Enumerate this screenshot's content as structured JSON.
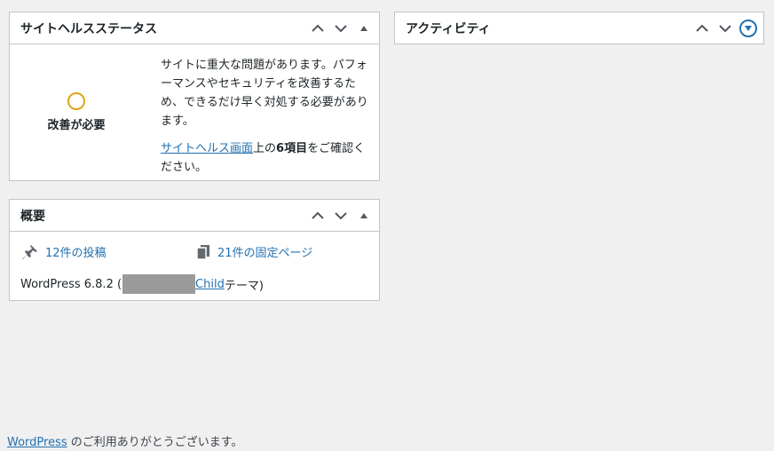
{
  "colors": {
    "background": "#f0f0f1",
    "link": "#2271b1",
    "warning_ring": "#dba617",
    "border": "#c3c4c7",
    "redaction": "#9a9a9a"
  },
  "health": {
    "title": "サイトヘルスステータス",
    "status_label": "改善が必要",
    "description": "サイトに重大な問題があります。パフォーマンスやセキュリティを改善するため、できるだけ早く対処する必要があります。",
    "link_text": "サイトヘルス画面",
    "suffix_before_count": "上の",
    "count_text": "6項目",
    "suffix_after_count": "をご確認ください。"
  },
  "activity": {
    "title": "アクティビティ"
  },
  "glance": {
    "title": "概要",
    "posts_label": "12件の投稿",
    "pages_label": "21件の固定ページ",
    "version_prefix": "WordPress 6.8.2 (",
    "theme_link": "Child",
    "version_suffix": " テーマ)"
  },
  "handles": {
    "up_icon": "chevron-up-icon",
    "down_icon": "chevron-down-icon",
    "toggle_icon": "triangle-up-icon"
  },
  "footer": {
    "link_text": "WordPress",
    "text": " のご利用ありがとうございます。"
  }
}
